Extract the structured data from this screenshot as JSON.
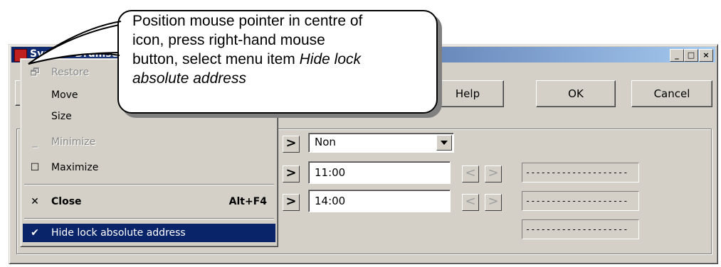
{
  "window": {
    "title": "System Drumset",
    "min_glyph": "_",
    "max_glyph": "□",
    "close_glyph": "×"
  },
  "toolbar": {
    "help_label": "Help",
    "ok_label": "OK",
    "cancel_label": "Cancel"
  },
  "form": {
    "arrow_glyph": ">",
    "left_glyph": "<",
    "right_glyph": ">",
    "select_value": "Non",
    "time_from": "11:00",
    "time_to": "14:00",
    "placeholder_lines": [
      "--------------------",
      "--------------------",
      "--------------------"
    ]
  },
  "system_menu": {
    "items": [
      {
        "label": "Restore",
        "icon": "restore-icon",
        "glyph": "🗗",
        "enabled": false
      },
      {
        "label": "Move",
        "enabled": true
      },
      {
        "label": "Size",
        "enabled": true
      },
      {
        "label": "Minimize",
        "icon": "minimize-icon",
        "glyph": "_",
        "enabled": false
      },
      {
        "label": "Maximize",
        "icon": "maximize-icon",
        "glyph": "☐",
        "enabled": true
      },
      {
        "label": "Close",
        "icon": "close-icon",
        "glyph": "✕",
        "accelerator": "Alt+F4",
        "enabled": true,
        "bold": true
      },
      {
        "label": "Hide lock absolute address",
        "icon": "check-icon",
        "glyph": "✔",
        "enabled": true,
        "selected": true
      }
    ]
  },
  "callout": {
    "line1": "Position mouse pointer in centre of",
    "line2": "icon, press right-hand mouse",
    "line3_prefix": "button, select menu item ",
    "line3_italic": "Hide lock",
    "line4_italic": "absolute address"
  },
  "colors": {
    "title_active": "#0a246a",
    "menu_highlight": "#0a246a",
    "face": "#d4d0c8"
  }
}
